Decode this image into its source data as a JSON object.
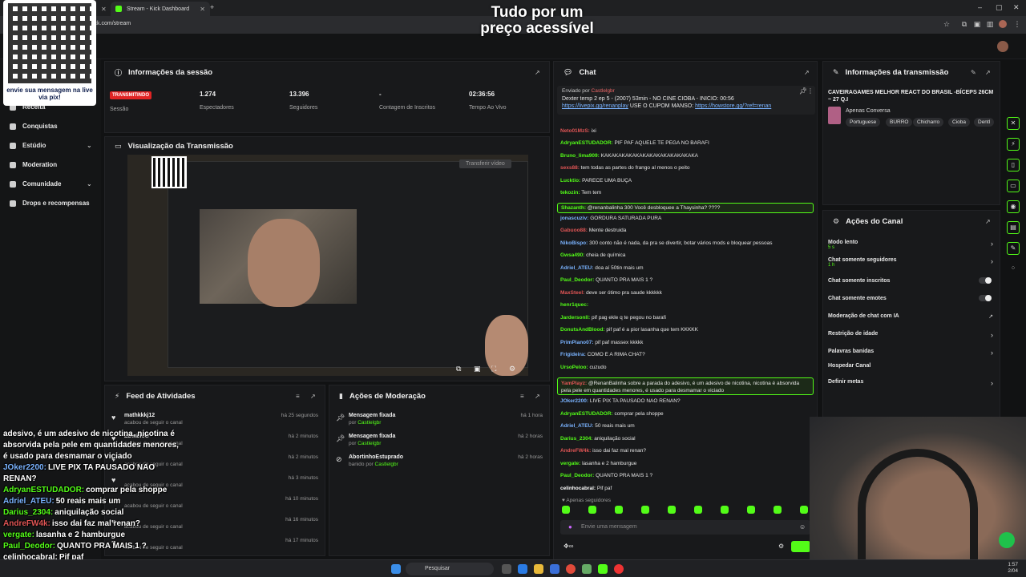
{
  "browser": {
    "tabs": [
      {
        "label": ""
      },
      {
        "label": "Stream - Kick Dashboard"
      }
    ],
    "url": "ick.com/stream"
  },
  "overlay": {
    "qr_caption": "envie sua mensagem na live via pix!",
    "promo_line1": "Tudo por um",
    "promo_line2": "preço acessível"
  },
  "sidebar": {
    "items": [
      {
        "label": "Receita",
        "chevron": ""
      },
      {
        "label": "Conquistas",
        "chevron": ""
      },
      {
        "label": "Estúdio",
        "chevron": "⌄"
      },
      {
        "label": "Moderation",
        "chevron": ""
      },
      {
        "label": "Comunidade",
        "chevron": "⌄"
      },
      {
        "label": "Drops e recompensas",
        "chevron": ""
      }
    ]
  },
  "session": {
    "title": "Informações da sessão",
    "badge": "TRANSMITINDO",
    "stats": [
      {
        "value": "",
        "label": "Sessão"
      },
      {
        "value": "1.274",
        "label": "Espectadores"
      },
      {
        "value": "13.396",
        "label": "Seguidores"
      },
      {
        "value": "-",
        "label": "Contagem de Inscritos"
      },
      {
        "value": "02:36:56",
        "label": "Tempo Ao Vivo"
      }
    ]
  },
  "preview": {
    "title": "Visualização da Transmissão",
    "transfer_label": "Transferir vídeo"
  },
  "activity": {
    "title": "Feed de Atividades",
    "items": [
      {
        "name": "mathkkkj12",
        "desc": "acabou de seguir o canal",
        "time": "há 25 segundos"
      },
      {
        "name": "ZDiabloO",
        "desc": "acabou de seguir o canal",
        "time": "há 2 minutos"
      },
      {
        "name": "",
        "desc": "acabou de seguir o canal",
        "time": "há 2 minutos"
      },
      {
        "name": "",
        "desc": "acabou de seguir o canal",
        "time": "há 3 minutos"
      },
      {
        "name": "",
        "desc": "acabou de seguir o canal",
        "time": "há 10 minutos"
      },
      {
        "name": "",
        "desc": "acabou de seguir o canal",
        "time": "há 16 minutos"
      },
      {
        "name": "",
        "desc": "acabou de seguir o canal",
        "time": "há 17 minutos"
      }
    ]
  },
  "moderation": {
    "title": "Ações de Moderação",
    "items": [
      {
        "name": "Mensagem fixada",
        "by": "por ",
        "who": "Castlelgbr",
        "time": "há 1 hora"
      },
      {
        "name": "Mensagem fixada",
        "by": "por ",
        "who": "Castlelgbr",
        "time": "há 2 horas"
      },
      {
        "name": "AbortinhoEstuprado",
        "by": "banido por ",
        "who": "Castlelgbr",
        "time": "há 2 horas"
      }
    ]
  },
  "chat": {
    "title": "Chat",
    "pinned": {
      "by_prefix": "Enviado por",
      "by_name": "Castlelgbr",
      "text": "Dexter temp 2 ep 5 - (2007) 53min - NO CINE CIOBA - INICIO: 00:56",
      "link1": "https://livepix.gg/renanplay",
      "mid": " USE O CUPOM MANSO: ",
      "link2": "https://howstore.gg/?ref=renan"
    },
    "messages": [
      {
        "user": "Neto01MzS:",
        "color": "#e05555",
        "text": "ixi"
      },
      {
        "user": "AdryanESTUDADOR:",
        "color": "#53fc18",
        "text": "PIF PAF AQUELE TE PEGA NO BARAFI"
      },
      {
        "user": "Bruno_lima909:",
        "color": "#53fc18",
        "text": "KAKAKAKAKAKAKAKAKAKAKAKAKAKA"
      },
      {
        "user": "sexs88:",
        "color": "#e05555",
        "text": "tem todas as partes do frango al menos o peito"
      },
      {
        "user": "Lucktio:",
        "color": "#53fc18",
        "text": "PARECE UMA BUÇA"
      },
      {
        "user": "tekozin:",
        "color": "#53fc18",
        "text": "Tem tem"
      },
      {
        "user": "Shazanth:",
        "color": "#53fc18",
        "text": "@renanbalinha 300 Você desbloquee a Thaysinha? ????"
      },
      {
        "user": "jonascuziv:",
        "color": "#7ab3ff",
        "text": "GORDURA SATURADA PURA"
      },
      {
        "user": "Gabuoo88:",
        "color": "#e05555",
        "text": "Mente destruida"
      },
      {
        "user": "NikoBispo:",
        "color": "#7ab3ff",
        "text": "300 conto não é nada, da pra se divertir, botar vários mods e bloquear pessoas"
      },
      {
        "user": "Gwsa490:",
        "color": "#53fc18",
        "text": "cheia de química"
      },
      {
        "user": "Adriel_ATEU:",
        "color": "#7ab3ff",
        "text": "doa aí 50tin mais um"
      },
      {
        "user": "Paul_Deodor:",
        "color": "#53fc18",
        "text": "QUANTO PRA MAIS 1 ?"
      },
      {
        "user": "MaxSteel:",
        "color": "#e05555",
        "text": "deve ser ótimo pra saude kkkkkk"
      },
      {
        "user": "henr1quec:",
        "color": "#53fc18",
        "text": ""
      },
      {
        "user": "Jardersonll:",
        "color": "#53fc18",
        "text": "pif pag ekle q te pegou no barafi"
      },
      {
        "user": "DonutsAndBlood:",
        "color": "#53fc18",
        "text": "pif paf é a pior lasanha que tem KKKKK"
      },
      {
        "user": "PrimPiano07:",
        "color": "#7ab3ff",
        "text": "pif paf massex kkkkk"
      },
      {
        "user": "Frigideira:",
        "color": "#7ab3ff",
        "text": "COMO É A RIMA CHAT?"
      },
      {
        "user": "UrsoPeloo:",
        "color": "#53fc18",
        "text": "cuzudo"
      },
      {
        "user": "YamPlayz:",
        "color": "#e05555",
        "text": "@RenanBalinha sobre a parada do adesivo, é um adesivo de nicotina, nicotina é absorvida pela pele em quantidades menores, é usado para desmamar o viciado"
      },
      {
        "user": "JOker2200:",
        "color": "#7ab3ff",
        "text": "LIVE PIX TA PAUSADO NAO RENAN?"
      },
      {
        "user": "AdryanESTUDADOR:",
        "color": "#53fc18",
        "text": "comprar pela shoppe"
      },
      {
        "user": "Adriel_ATEU:",
        "color": "#7ab3ff",
        "text": "50 reais mais um"
      },
      {
        "user": "Darius_2304:",
        "color": "#53fc18",
        "text": "aniquilação social"
      },
      {
        "user": "AndreFW4k:",
        "color": "#e05555",
        "text": "isso dai faz mal renan?"
      },
      {
        "user": "vergate:",
        "color": "#53fc18",
        "text": "lasanha e 2 hamburgue"
      },
      {
        "user": "Paul_Deodor:",
        "color": "#53fc18",
        "text": "QUANTO PRA MAIS 1 ?"
      },
      {
        "user": "celinhocabral:",
        "color": "#ffffff",
        "text": "Pif paf"
      }
    ],
    "only_followers": "Apenas seguidores",
    "input_placeholder": "Envie uma mensagem"
  },
  "transmission": {
    "title": "Informações da transmissão",
    "stream_title": "CAVEIRAGAMES MELHOR REACT DO BRASIL -BÍCEPS 26CM ~ 27 Q.I",
    "category": "Apenas Conversa",
    "tags": [
      "Portuguese",
      "BURRO",
      "Chicharro",
      "Cioba",
      "Dentl"
    ]
  },
  "channel_actions": {
    "title": "Ações do Canal",
    "items": [
      {
        "label": "Modo lento",
        "sub": "5 s",
        "control": "arrow"
      },
      {
        "label": "Chat somente seguidores",
        "sub": "1 h",
        "control": "arrow"
      },
      {
        "label": "Chat somente inscritos",
        "sub": "",
        "control": "toggle"
      },
      {
        "label": "Chat somente emotes",
        "sub": "",
        "control": "toggle"
      },
      {
        "label": "Moderação de chat com IA",
        "sub": "",
        "control": "ext"
      },
      {
        "label": "Restrição de idade",
        "sub": "",
        "control": "arrow"
      },
      {
        "label": "Palavras banidas",
        "sub": "",
        "control": "arrow"
      },
      {
        "label": "Hospedar Canal",
        "sub": "",
        "control": "none"
      },
      {
        "label": "Definir metas",
        "sub": "",
        "control": "arrow"
      }
    ]
  },
  "overlay_chat": [
    {
      "user": "",
      "text": "adesivo, é um adesivo de nicotina, nicotina é"
    },
    {
      "user": "",
      "text": "absorvida pela pele em quantidades menores,"
    },
    {
      "user": "",
      "text": "é usado para desmamar o viciado"
    },
    {
      "user": "JOker2200:",
      "text": "LIVE PIX TA PAUSADO NAO"
    },
    {
      "user": "",
      "text": "RENAN?"
    },
    {
      "user": "AdryanESTUDADOR:",
      "text": "comprar pela shoppe"
    },
    {
      "user": "Adriel_ATEU:",
      "text": "50 reais mais um"
    },
    {
      "user": "Darius_2304:",
      "text": "aniquilação social"
    },
    {
      "user": "AndreFW4k:",
      "text": "isso dai faz mal renan?"
    },
    {
      "user": "vergate:",
      "text": "lasanha e 2 hamburgue"
    },
    {
      "user": "Paul_Deodor:",
      "text": "QUANTO PRA MAIS 1 ?"
    },
    {
      "user": "celinhocabral:",
      "text": "Pif paf"
    }
  ],
  "taskbar": {
    "search": "Pesquisar",
    "time": "1:57",
    "date": "2/04"
  },
  "colors": {
    "accent": "#53fc18",
    "live": "#e02424",
    "panel": "#18191b"
  }
}
